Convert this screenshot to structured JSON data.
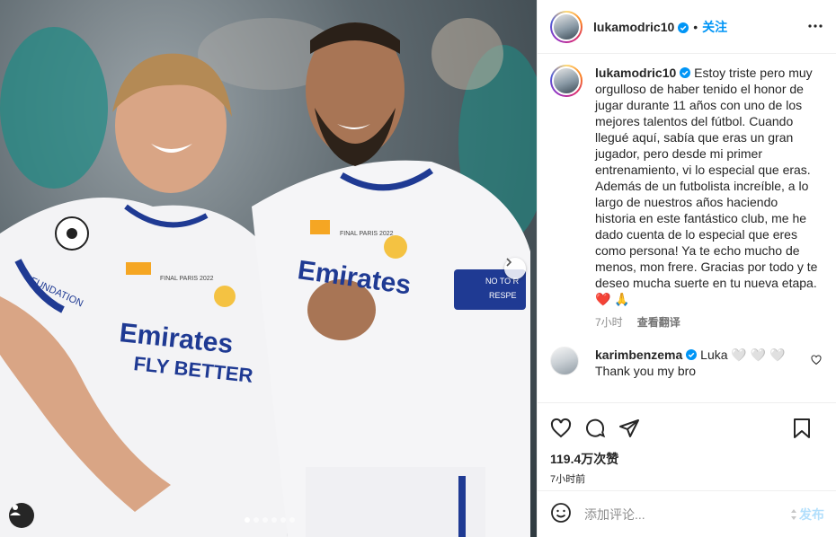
{
  "post": {
    "username": "lukamodric10",
    "separator": "•",
    "follow_label": "关注",
    "caption": "Estoy triste pero muy orgulloso de haber tenido el honor de jugar durante 11 años con uno de los mejores talentos del fútbol. Cuando llegué aquí, sabía que eras un gran jugador, pero desde mi primer entrenamiento, vi lo especial que eras. Además de un futbolista increíble, a lo largo de nuestros años haciendo historia en este fantástico club, me he dado cuenta de lo especial que eres como persona! Ya te echo mucho de menos, mon frere. Gracias por todo y te deseo mucha suerte en tu nueva etapa. ❤️ 🙏",
    "caption_time": "7小时",
    "translate_label": "查看翻译"
  },
  "comment": {
    "username": "karimbenzema",
    "text_line1": "Luka 🤍 🤍 🤍",
    "text_line2": "Thank you my bro"
  },
  "actions": {
    "likes": "119.4万次赞",
    "time_ago": "7小时前"
  },
  "composer": {
    "placeholder": "添加评论...",
    "post_label": "发布"
  },
  "media": {
    "jersey_text_1": "Emirates",
    "jersey_text_2": "FLY BETTER",
    "jersey_text_3": "Emirates",
    "armband_text": "NO TO R",
    "armband_text_2": "RESPE",
    "final_text": "FINAL PARIS 2022",
    "carousel_count": 6,
    "carousel_active": 0
  },
  "colors": {
    "accent": "#0095f6",
    "post_disabled": "#b2dffc",
    "jersey_blue": "#1f3a93"
  }
}
